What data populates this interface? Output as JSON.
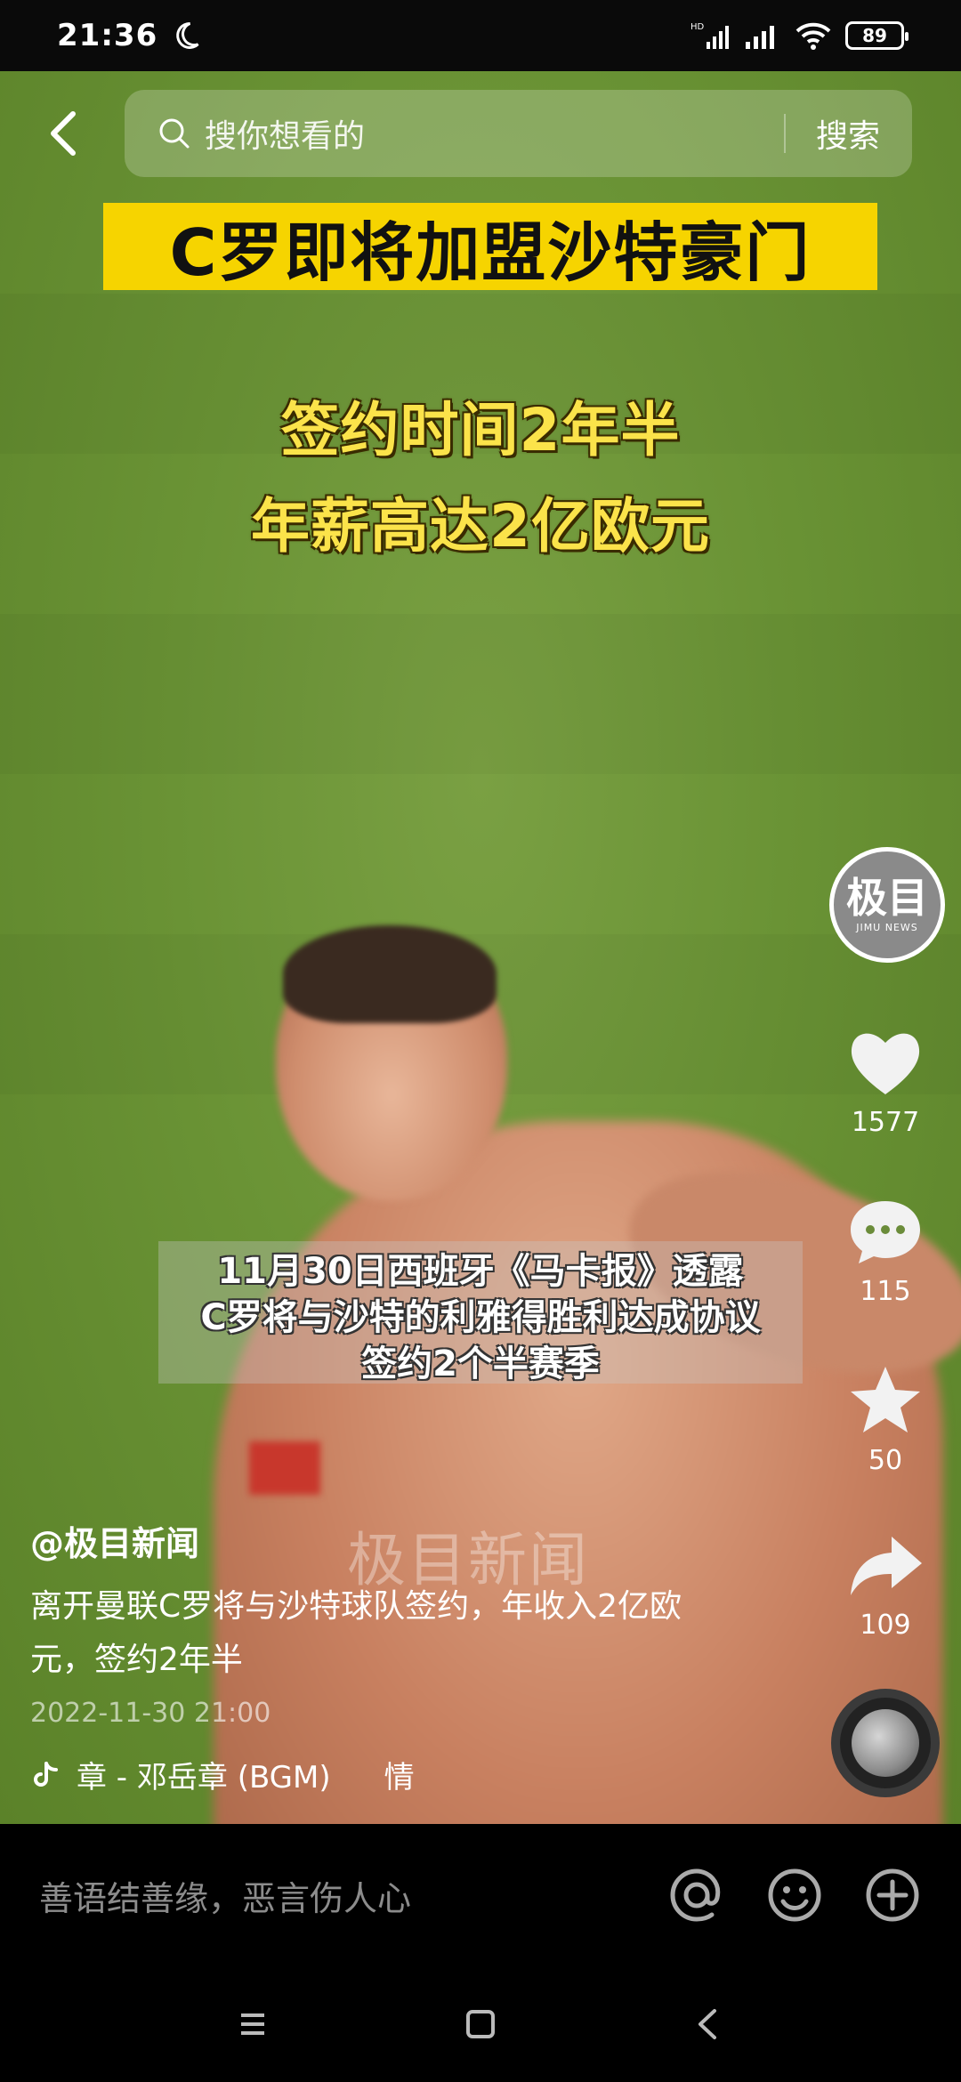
{
  "status_bar": {
    "time": "21:36",
    "battery": "89",
    "network_label": "HD"
  },
  "search": {
    "placeholder": "搜你想看的",
    "button": "搜索"
  },
  "video": {
    "headline": "C罗即将加盟沙特豪门",
    "sub_line_1": "签约时间2年半",
    "sub_line_2": "年薪高达2亿欧元",
    "caption_line_1": "11月30日西班牙《马卡报》透露",
    "caption_line_2": "C罗将与沙特的利雅得胜利达成协议",
    "caption_line_3": "签约2个半赛季",
    "watermark": "极目新闻"
  },
  "account": {
    "avatar_text": "极目",
    "avatar_sub": "JIMU NEWS"
  },
  "actions": {
    "likes": "1577",
    "comments": "115",
    "favorites": "50",
    "shares": "109"
  },
  "post": {
    "author": "@极目新闻",
    "description": "离开曼联C罗将与沙特球队签约，年收入2亿欧元，签约2年半",
    "date": "2022-11-30 21:00",
    "music": "章 - 邓岳章 (BGM)",
    "music_extra": "情"
  },
  "comment_bar": {
    "placeholder": "善语结善缘，恶言伤人心"
  },
  "colors": {
    "headline_bg": "#f6d400",
    "subtitle_text": "#fbe34a",
    "field_green": "#6a9335"
  }
}
